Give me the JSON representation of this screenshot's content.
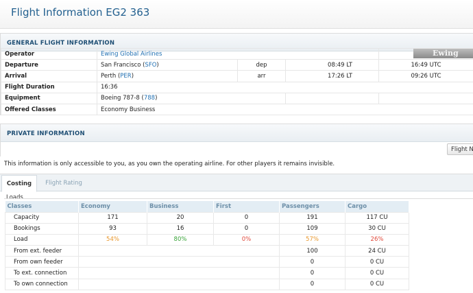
{
  "page": {
    "title": "Flight Information EG2 363"
  },
  "general": {
    "heading": "GENERAL FLIGHT INFORMATION",
    "logo_text": "Ewing",
    "operator": {
      "label": "Operator",
      "value": "Ewing Global Airlines"
    },
    "departure": {
      "label": "Departure",
      "city": "San Francisco (",
      "code": "SFO",
      "close": ")",
      "type": "dep",
      "local": "08:49 LT",
      "utc": "16:49 UTC"
    },
    "arrival": {
      "label": "Arrival",
      "city": "Perth (",
      "code": "PER",
      "close": ")",
      "type": "arr",
      "local": "17:26 LT",
      "utc": "09:26 UTC"
    },
    "duration": {
      "label": "Flight Duration",
      "value": "16:36"
    },
    "equipment": {
      "label": "Equipment",
      "value": "Boeing 787-8 (",
      "code": "788",
      "close": ")"
    },
    "classes": {
      "label": "Offered Classes",
      "value": "Economy Business"
    }
  },
  "private": {
    "heading": "PRIVATE INFORMATION",
    "button_label": "Flight Nu",
    "notice": "This information is only accessible to you, as you own the operating airline. For other players it remains invisible."
  },
  "tabs": [
    {
      "label": "Costing"
    },
    {
      "label": "Flight Rating"
    }
  ],
  "loads": {
    "label": "Loads",
    "headers": [
      "Classes",
      "Economy",
      "Business",
      "First",
      "Passengers",
      "Cargo"
    ],
    "rows": [
      {
        "label": "Capacity",
        "economy": "171",
        "business": "20",
        "first": "0",
        "passengers": "191",
        "cargo": "117 CU"
      },
      {
        "label": "Bookings",
        "economy": "93",
        "business": "16",
        "first": "0",
        "passengers": "109",
        "cargo": "30 CU"
      },
      {
        "label": "Load",
        "economy": "54%",
        "business": "80%",
        "first": "0%",
        "passengers": "57%",
        "cargo": "26%"
      },
      {
        "label": "From ext. feeder",
        "passengers": "100",
        "cargo": "24 CU"
      },
      {
        "label": "From own feeder",
        "passengers": "0",
        "cargo": "0 CU"
      },
      {
        "label": "To ext. connection",
        "passengers": "0",
        "cargo": "0 CU"
      },
      {
        "label": "To own connection",
        "passengers": "0",
        "cargo": "0 CU"
      }
    ]
  },
  "colors": {
    "title": "#23608f",
    "link": "#1f6fb2",
    "load_orange": "#e8962a",
    "load_green": "#3aa43a",
    "load_red": "#e04a3c"
  }
}
